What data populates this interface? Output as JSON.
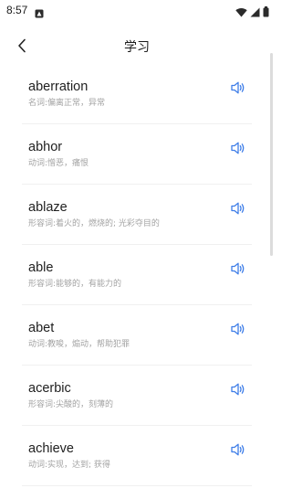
{
  "status_bar": {
    "time": "8:57",
    "icons": [
      "notification-icon",
      "wifi-icon",
      "signal-icon",
      "battery-icon"
    ]
  },
  "header": {
    "title": "学习",
    "back_icon": "chevron-left-icon"
  },
  "colors": {
    "accent": "#3f7ee8",
    "word": "#1f1f1f",
    "meaning": "#a3a3a3",
    "divider": "#f0f0f0"
  },
  "words": [
    {
      "word": "aberration",
      "meaning": "名词:偏离正常，异常"
    },
    {
      "word": "abhor",
      "meaning": "动词:憎恶，痛恨"
    },
    {
      "word": "ablaze",
      "meaning": "形容词:着火的，燃烧的; 光彩夺目的"
    },
    {
      "word": "able",
      "meaning": "形容词:能够的，有能力的"
    },
    {
      "word": "abet",
      "meaning": "动词:教唆，煽动，帮助犯罪"
    },
    {
      "word": "acerbic",
      "meaning": "形容词:尖酸的，刻薄的"
    },
    {
      "word": "achieve",
      "meaning": "动词:实现，达到; 获得"
    }
  ]
}
